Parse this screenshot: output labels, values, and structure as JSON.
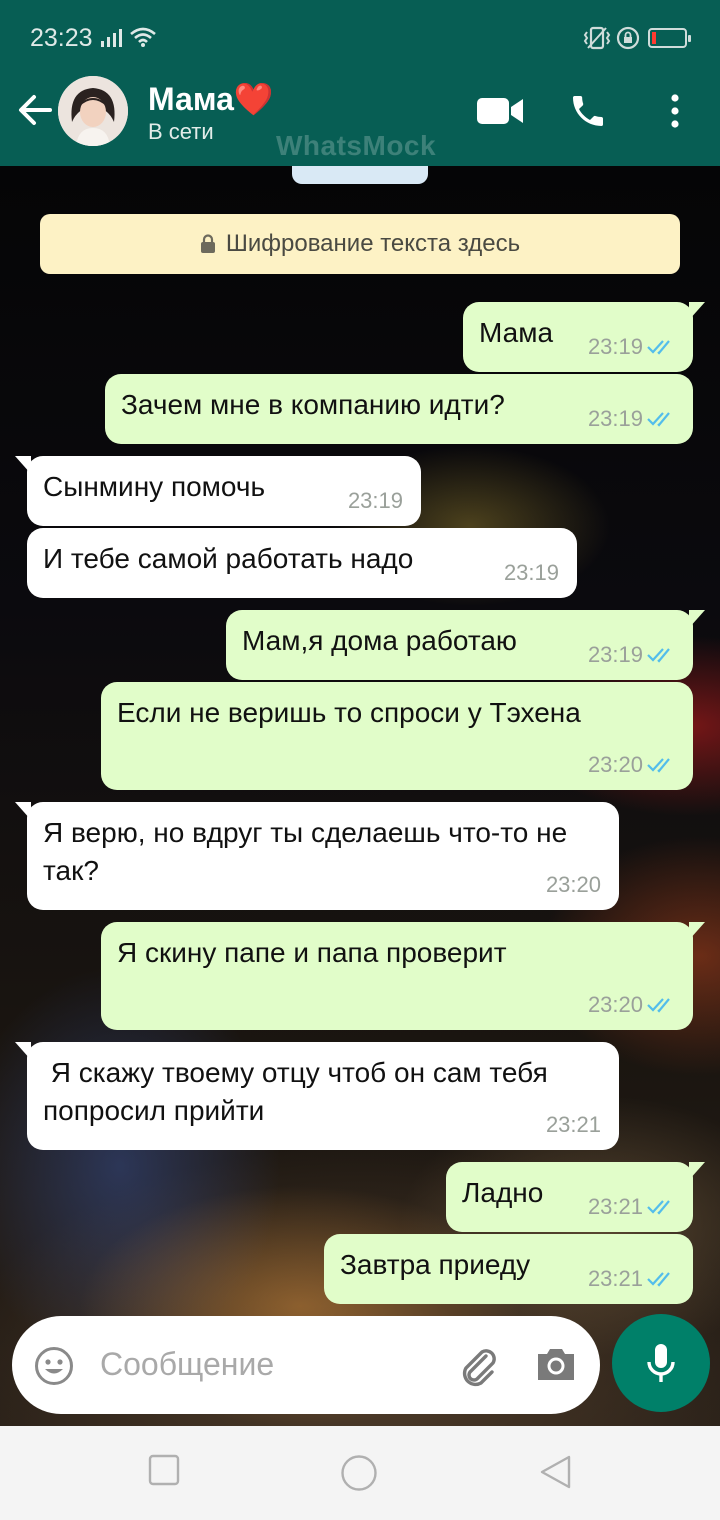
{
  "status_bar": {
    "time": "23:23",
    "icons": [
      "signal-icon",
      "wifi-icon",
      "vibrate-icon",
      "alarm-lock-icon",
      "battery-low-icon"
    ],
    "battery_color": "#ff3b30"
  },
  "header": {
    "contact_name": "Мама",
    "name_emoji": "❤️",
    "presence": "В сети",
    "watermark": "WhatsMock",
    "actions": [
      "video-call-icon",
      "voice-call-icon",
      "more-options-icon"
    ],
    "colors": {
      "bar": "#075e54",
      "accent": "#008069"
    }
  },
  "encryption_notice": "Шифрование текста здесь",
  "messages": [
    {
      "dir": "out",
      "text": "Мама",
      "time": "23:19",
      "read": true
    },
    {
      "dir": "out",
      "text": "Зачем мне в компанию идти?",
      "time": "23:19",
      "read": true
    },
    {
      "dir": "in",
      "text": "Сынмину помочь",
      "time": "23:19"
    },
    {
      "dir": "in",
      "text": "И тебе самой работать надо",
      "time": "23:19"
    },
    {
      "dir": "out",
      "text": "Мам,я дома работаю",
      "time": "23:19",
      "read": true
    },
    {
      "dir": "out",
      "text": "Если не веришь то спроси у Тэхена",
      "time": "23:20",
      "read": true
    },
    {
      "dir": "in",
      "text": "Я верю, но вдруг ты сделаешь что-то не так?",
      "time": "23:20"
    },
    {
      "dir": "out",
      "text": "Я скину папе и папа проверит",
      "time": "23:20",
      "read": true
    },
    {
      "dir": "in",
      "text": " Я скажу твоему отцу чтоб он сам тебя попросил прийти",
      "time": "23:21"
    },
    {
      "dir": "out",
      "text": "Ладно",
      "time": "23:21",
      "read": true
    },
    {
      "dir": "out",
      "text": "Завтра приеду",
      "time": "23:21",
      "read": true
    }
  ],
  "composer": {
    "placeholder": "Сообщение",
    "icons": [
      "emoji-icon",
      "attach-icon",
      "camera-icon",
      "mic-icon"
    ]
  },
  "nav_bar": {
    "buttons": [
      "recents-icon",
      "home-icon",
      "back-icon"
    ]
  },
  "colors": {
    "bubble_out": "#e1fdc9",
    "bubble_in": "#ffffff",
    "read_ticks": "#53bdeb",
    "notice_bg": "#fdf2c5"
  }
}
